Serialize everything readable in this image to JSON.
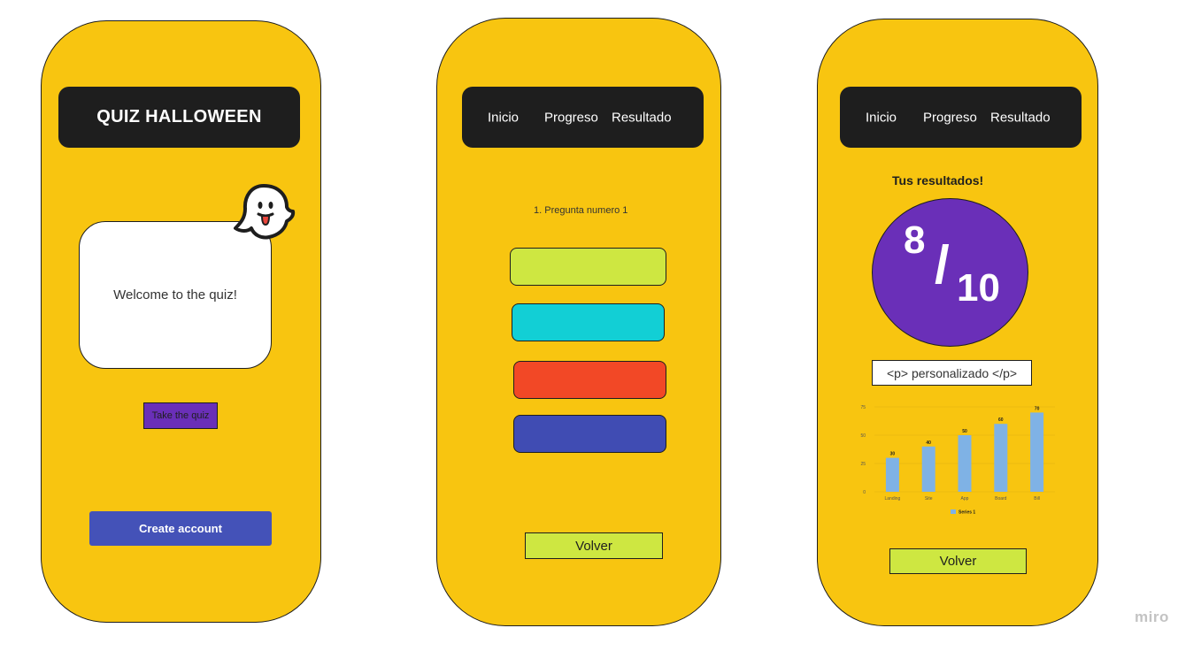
{
  "screen1": {
    "title": "QUIZ HALLOWEEN",
    "welcome_text": "Welcome to the quiz!",
    "take_quiz_label": "Take the quiz",
    "create_account_label": "Create account",
    "mascot_icon": "ghost-icon"
  },
  "nav": {
    "inicio": "Inicio",
    "progreso": "Progreso",
    "resultado": "Resultado"
  },
  "screen2": {
    "question": "1. Pregunta numero 1",
    "answer_colors": [
      "#cee741",
      "#12cfd5",
      "#f24826",
      "#404cb3"
    ],
    "volver_label": "Volver"
  },
  "screen3": {
    "results_title": "Tus resultados!",
    "score": "8",
    "score_separator": "/",
    "score_total": "10",
    "custom_paragraph": "<p> personalizado </p>",
    "volver_label": "Volver"
  },
  "chart_data": {
    "type": "bar",
    "categories": [
      "Landing",
      "Site",
      "App",
      "Board",
      "Bill"
    ],
    "series": [
      {
        "name": "Series 1",
        "values": [
          30,
          40,
          50,
          60,
          70
        ],
        "color": "#7fb2e5"
      }
    ],
    "ylim": [
      0,
      75
    ],
    "yticks": [
      0,
      25,
      50,
      75
    ],
    "grid": true,
    "legend": "bottom"
  },
  "colors": {
    "phone_bg": "#f8c510",
    "bar_bg": "#1e1e1e",
    "purple": "#6a2fb8",
    "blue_button": "#4452b8",
    "lime": "#cee741"
  },
  "watermark": "miro"
}
